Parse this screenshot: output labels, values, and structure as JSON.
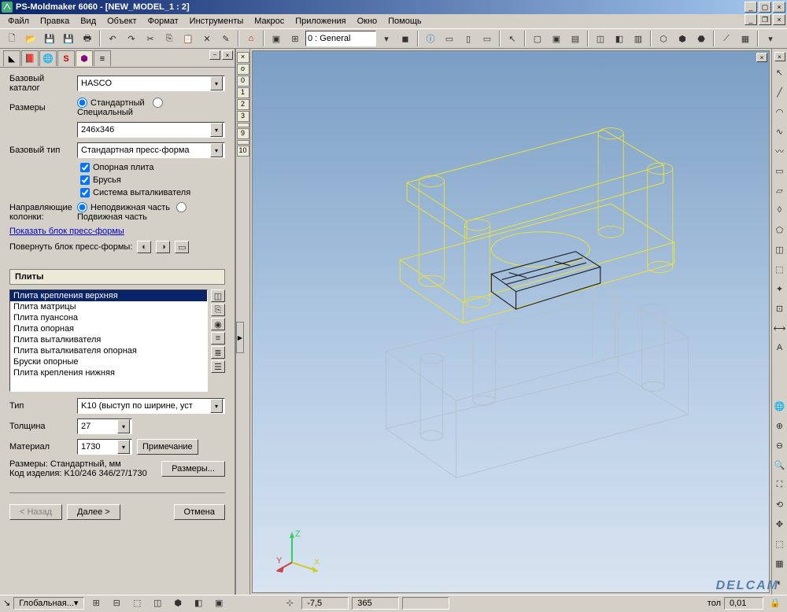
{
  "app": {
    "title": "PS-Moldmaker 6060 - [NEW_MODEL_1 : 2]"
  },
  "menu": [
    "Файл",
    "Правка",
    "Вид",
    "Объект",
    "Формат",
    "Инструменты",
    "Макрос",
    "Приложения",
    "Окно",
    "Помощь"
  ],
  "toolbar": {
    "layer_combo": "0  : General"
  },
  "panel": {
    "base_catalog_lbl": "Базовый каталог",
    "base_catalog": "HASCO",
    "sizes_lbl": "Размеры",
    "std_radio": "Стандартный",
    "special_radio": "Специальный",
    "size_combo": "246x346",
    "base_type_lbl": "Базовый тип",
    "base_type": "Стандартная пресс-форма",
    "chk1": "Опорная плита",
    "chk2": "Брусья",
    "chk3": "Система выталкивателя",
    "guide_cols_lbl": "Направляющие колонки:",
    "fixed_radio": "Неподвижная часть",
    "moving_radio": "Подвижная часть",
    "show_link": "Показать блок пресс-формы",
    "rotate_lbl": "Повернуть блок пресс-формы:",
    "section_plates": "Плиты",
    "plates": [
      "Плита крепления верхняя",
      "Плита матрицы",
      "Плита пуансона",
      "Плита опорная",
      "Плита выталкивателя",
      "Плита выталкивателя опорная",
      "Бруски опорные",
      "Плита крепления нижняя"
    ],
    "type_lbl": "Тип",
    "type_val": "K10 (выступ по ширине, уст",
    "thick_lbl": "Толщина",
    "thick_val": "27",
    "mat_lbl": "Материал",
    "mat_val": "1730",
    "note_btn": "Примечание",
    "sizes_info_lbl": "Размеры:",
    "sizes_info_val": "Стандартный, мм",
    "code_lbl": "Код изделия:",
    "code_val": "K10/246 346/27/1730",
    "sizes_btn": "Размеры...",
    "back_btn": "< Назад",
    "next_btn": "Далее >",
    "cancel_btn": "Отмена"
  },
  "ruler": [
    "×",
    "о",
    "0",
    "1",
    "2",
    "3",
    "",
    "9",
    "",
    "10"
  ],
  "status": {
    "mode": "Глобальная...",
    "x": "-7,5",
    "y": "365",
    "tol": "0,01"
  },
  "logo": "DELCAM"
}
